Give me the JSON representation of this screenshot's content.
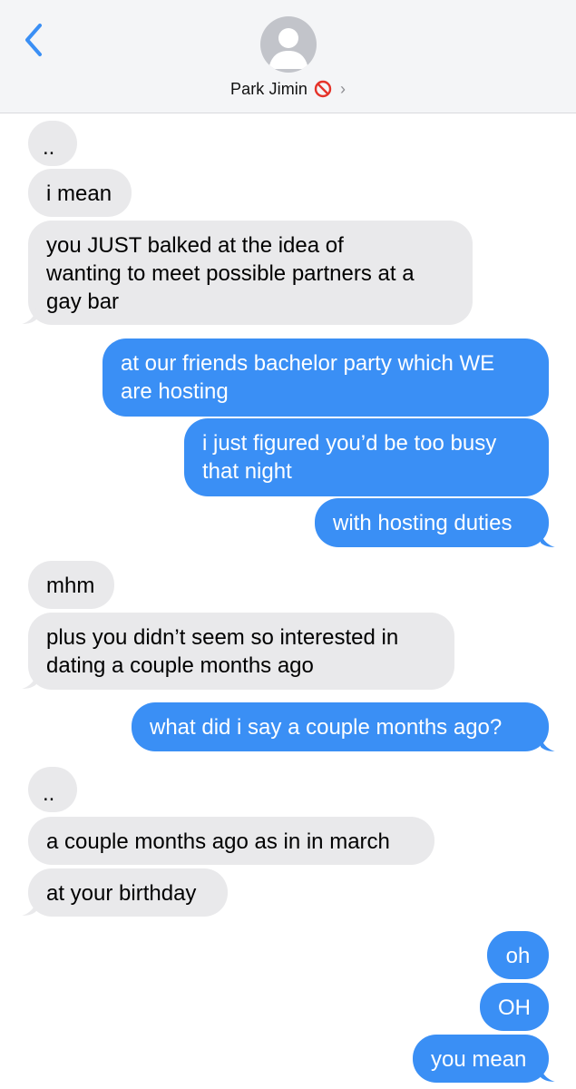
{
  "header": {
    "contact_name": "Park Jimin",
    "blocked_icon": "no-entry-icon",
    "chevron": "›",
    "back_icon": "chevron-left-icon",
    "avatar_icon": "person-silhouette-icon",
    "accent": "#3a8ff5"
  },
  "messages": [
    {
      "id": "m1",
      "direction": "incoming",
      "text": ".."
    },
    {
      "id": "m2",
      "direction": "incoming",
      "text": "i mean"
    },
    {
      "id": "m3",
      "direction": "incoming",
      "text": "you JUST balked at the idea of\nwanting to meet possible partners at a\ngay bar"
    },
    {
      "id": "m4",
      "direction": "outgoing",
      "text": "at our friends bachelor party which WE\nare hosting"
    },
    {
      "id": "m5",
      "direction": "outgoing",
      "text": "i just figured you’d be too busy\nthat night"
    },
    {
      "id": "m6",
      "direction": "outgoing",
      "text": "with hosting duties"
    },
    {
      "id": "m7",
      "direction": "incoming",
      "text": "mhm"
    },
    {
      "id": "m8",
      "direction": "incoming",
      "text": "plus you didn’t seem so interested in\ndating a couple months ago"
    },
    {
      "id": "m9",
      "direction": "outgoing",
      "text": "what did i say a couple months ago?"
    },
    {
      "id": "m10",
      "direction": "incoming",
      "text": ".."
    },
    {
      "id": "m11",
      "direction": "incoming",
      "text": "a couple months ago as in in march"
    },
    {
      "id": "m12",
      "direction": "incoming",
      "text": "at your birthday"
    },
    {
      "id": "m13",
      "direction": "outgoing",
      "text": "oh"
    },
    {
      "id": "m14",
      "direction": "outgoing",
      "text": "OH"
    },
    {
      "id": "m15",
      "direction": "outgoing",
      "text": "you mean"
    }
  ],
  "colors": {
    "incoming_bubble": "#e9e9eb",
    "outgoing_bubble": "#3a8ff5",
    "header_bg": "#f4f5f7"
  }
}
